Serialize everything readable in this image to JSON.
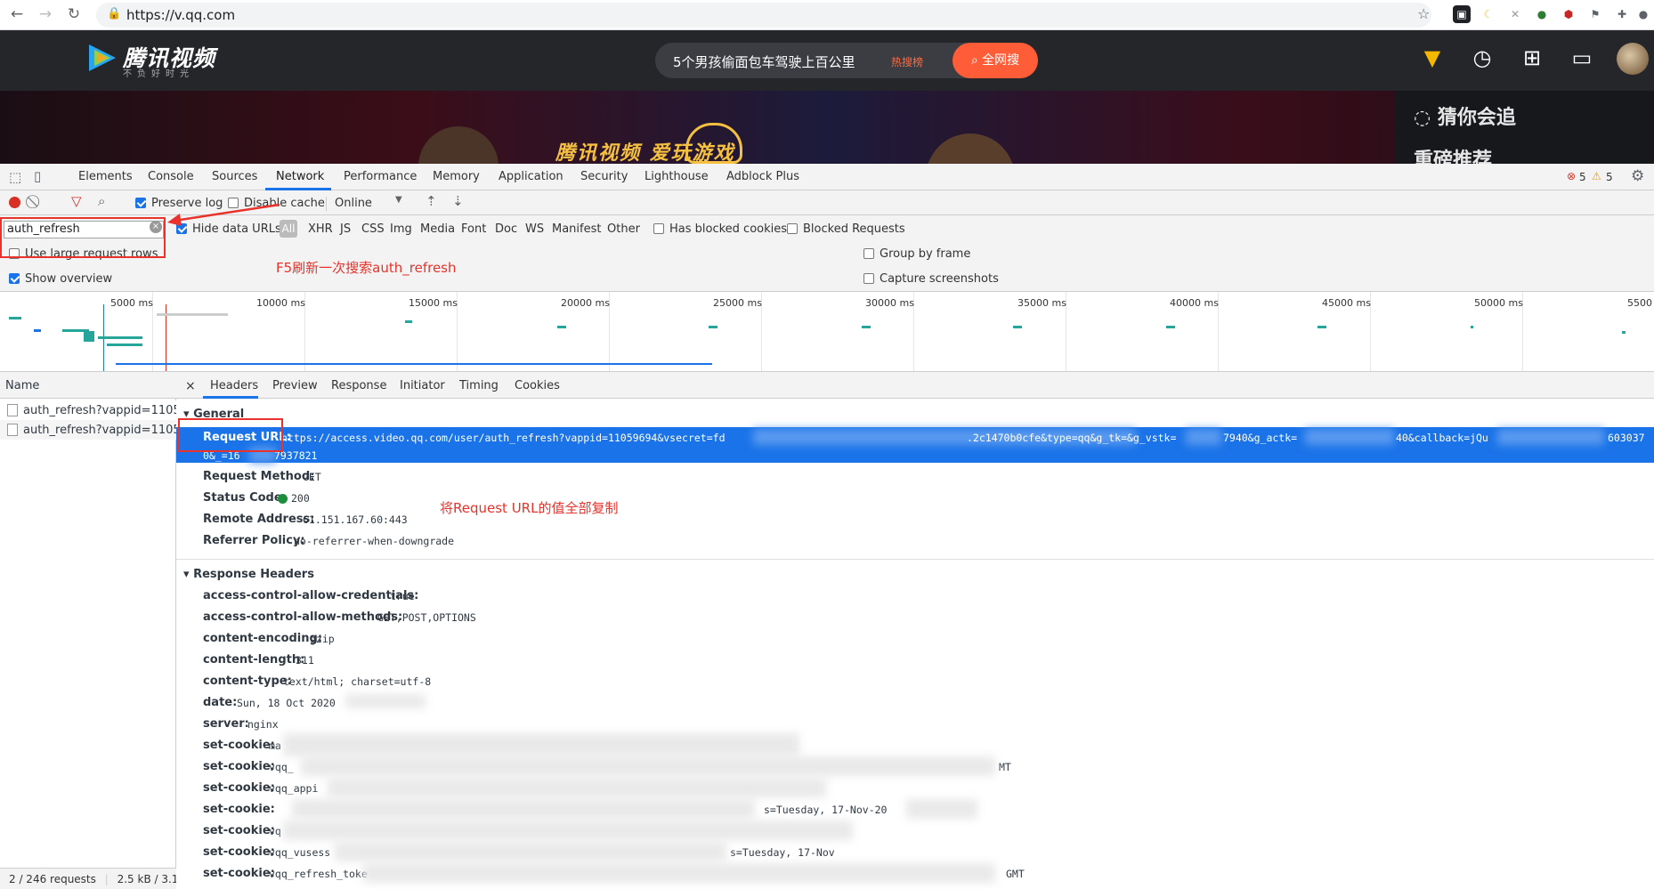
{
  "browser": {
    "url": "https://v.qq.com"
  },
  "site": {
    "logo_text": "腾讯视频",
    "slogan": "不负好时光",
    "search_text": "5个男孩偷面包车驾驶上百公里",
    "hot_rank": "热搜榜",
    "search_button": "全网搜",
    "banner_logos": "腾讯视频   爱玩游戏",
    "guess_label": "猜你会追",
    "hot_rec_label": "重磅推荐"
  },
  "devtools": {
    "tabs": [
      "Elements",
      "Console",
      "Sources",
      "Network",
      "Performance",
      "Memory",
      "Application",
      "Security",
      "Lighthouse",
      "Adblock Plus"
    ],
    "errors": "5",
    "warnings": "5",
    "toolbar": {
      "preserve_log": "Preserve log",
      "disable_cache": "Disable cache",
      "throttle": "Online"
    },
    "filter": {
      "value": "auth_refresh",
      "hide_data_urls": "Hide data URLs",
      "all": "All",
      "types": [
        "XHR",
        "JS",
        "CSS",
        "Img",
        "Media",
        "Font",
        "Doc",
        "WS",
        "Manifest",
        "Other"
      ],
      "has_blocked_cookies": "Has blocked cookies",
      "blocked_requests": "Blocked Requests"
    },
    "settings": {
      "large_rows": "Use large request rows",
      "show_overview": "Show overview",
      "group_by_frame": "Group by frame",
      "capture_screenshots": "Capture screenshots"
    },
    "timeline_ticks": [
      "5000 ms",
      "10000 ms",
      "15000 ms",
      "20000 ms",
      "25000 ms",
      "30000 ms",
      "35000 ms",
      "40000 ms",
      "45000 ms",
      "50000 ms",
      "5500"
    ],
    "requests": {
      "name_header": "Name",
      "rows": [
        "auth_refresh?vappid=1105...",
        "auth_refresh?vappid=1105..."
      ],
      "status": "2 / 246 requests",
      "size": "2.5 kB / 3.1"
    },
    "detail_tabs": [
      "Headers",
      "Preview",
      "Response",
      "Initiator",
      "Timing",
      "Cookies"
    ],
    "general": {
      "title": "General",
      "request_url_key": "Request URL:",
      "request_url_line1": "https://access.video.qq.com/user/auth_refresh?vappid=11059694&vsecret=fd",
      "request_url_mid": ".2c1470b0cfe&type=qq&g_tk=&g_vstk=",
      "request_url_mid2": "7940&g_actk=",
      "request_url_mid3": "40&callback=jQu",
      "request_url_end": "603037",
      "request_url_line2a": "0&_=16",
      "request_url_line2b": "7937821",
      "method_key": "Request Method:",
      "method_val": "GET",
      "status_key": "Status Code:",
      "status_val": "200",
      "remote_key": "Remote Address:",
      "remote_val": "61.151.167.60:443",
      "referrer_key": "Referrer Policy:",
      "referrer_val": "no-referrer-when-downgrade"
    },
    "response_headers": {
      "title": "Response Headers",
      "items": [
        {
          "k": "access-control-allow-credentials:",
          "v": "true"
        },
        {
          "k": "access-control-allow-methods:",
          "v": "GET,POST,OPTIONS"
        },
        {
          "k": "content-encoding:",
          "v": "gzip"
        },
        {
          "k": "content-length:",
          "v": "311"
        },
        {
          "k": "content-type:",
          "v": "text/html; charset=utf-8"
        },
        {
          "k": "date:",
          "v": "Sun, 18 Oct 2020"
        },
        {
          "k": "server:",
          "v": "nginx"
        },
        {
          "k": "set-cookie:",
          "v": "ma"
        },
        {
          "k": "set-cookie:",
          "v": "vqq_"
        },
        {
          "k": "set-cookie:",
          "v": "vqq_appi"
        },
        {
          "k": "set-cookie:",
          "v": ""
        },
        {
          "k": "set-cookie:",
          "v": "vq"
        },
        {
          "k": "set-cookie:",
          "v": "vqq_vusess"
        },
        {
          "k": "set-cookie:",
          "v": "vqq_refresh_toke"
        }
      ],
      "trail_1": "MT",
      "trail_2": "s=Tuesday, 17-Nov-20",
      "trail_3": "s=Tuesday, 17-Nov",
      "trail_4": "GMT"
    }
  },
  "annotations": {
    "search_note": "F5刷新一次搜索auth_refresh",
    "copy_note": "将Request URL的值全部复制"
  },
  "colors": {
    "accent": "#1a73e8",
    "annotation": "#e8322b",
    "site_header": "#24262a",
    "search_button": "#ff5c38"
  }
}
